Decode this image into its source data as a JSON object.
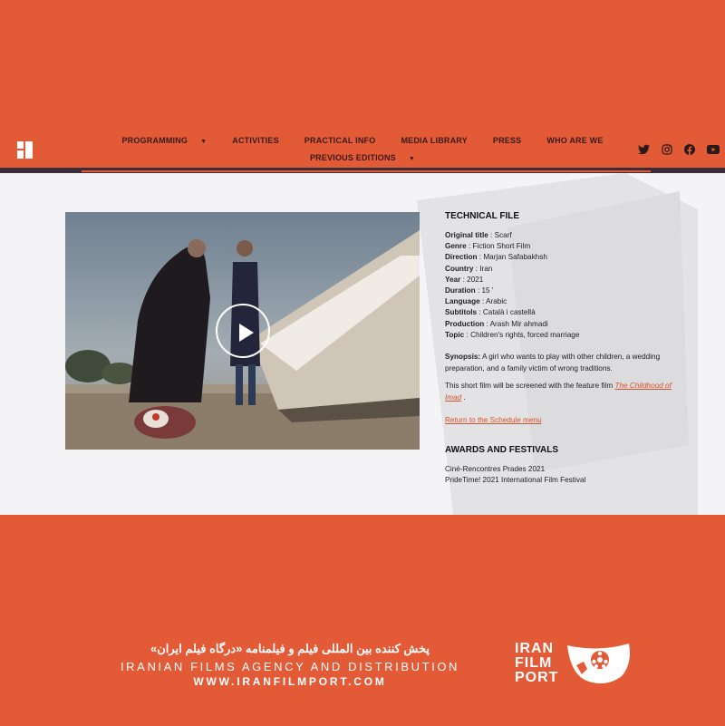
{
  "nav": {
    "items": [
      {
        "label": "PROGRAMMING",
        "has_caret": true
      },
      {
        "label": "ACTIVITIES"
      },
      {
        "label": "PRACTICAL INFO"
      },
      {
        "label": "MEDIA LIBRARY"
      },
      {
        "label": "PRESS"
      },
      {
        "label": "WHO ARE WE"
      },
      {
        "label": "PREVIOUS EDITIONS",
        "has_caret": true
      }
    ],
    "socials": [
      "twitter-icon",
      "instagram-icon",
      "facebook-icon",
      "youtube-icon"
    ]
  },
  "technical_file": {
    "heading": "TECHNICAL FILE",
    "rows": [
      {
        "label": "Original title",
        "value": "Scarf"
      },
      {
        "label": "Genre",
        "value": "Fiction Short Film"
      },
      {
        "label": "Direction",
        "value": "Marjan Safabakhsh"
      },
      {
        "label": "Country",
        "value": "Iran"
      },
      {
        "label": "Year",
        "value": "2021"
      },
      {
        "label": "Duration",
        "value": "15 '"
      },
      {
        "label": "Language",
        "value": "Arabic"
      },
      {
        "label": "Subtitols",
        "value": "Català i castellà"
      },
      {
        "label": "Production",
        "value": "Arash Mir ahmadi"
      },
      {
        "label": "Topic",
        "value": "Children's rights, forced marriage"
      }
    ],
    "synopsis_label": "Synopsis:",
    "synopsis": "A girl who wants to play with other children, a wedding preparation, and a family victim of wrong traditions.",
    "screened_prefix": "This short film will be screened with the feature film ",
    "screened_film": "The Childhood of Imad",
    "screened_suffix": " .",
    "return_link": "Return to the Schedule menu"
  },
  "awards": {
    "heading": "AWARDS AND FESTIVALS",
    "items": [
      "Ciné-Rencontres Prades 2021",
      "PrideTime! 2021 International Film Festival"
    ]
  },
  "footer": {
    "persian": "پخش کننده بین المللی فیلم و فیلمنامه «درگاه فیلم ایران»",
    "english": "IRANIAN FILMS AGENCY AND DISTRIBUTION",
    "url": "WWW.IRANFILMPORT.COM",
    "brand": [
      "IRAN",
      "FILM",
      "PORT"
    ]
  }
}
